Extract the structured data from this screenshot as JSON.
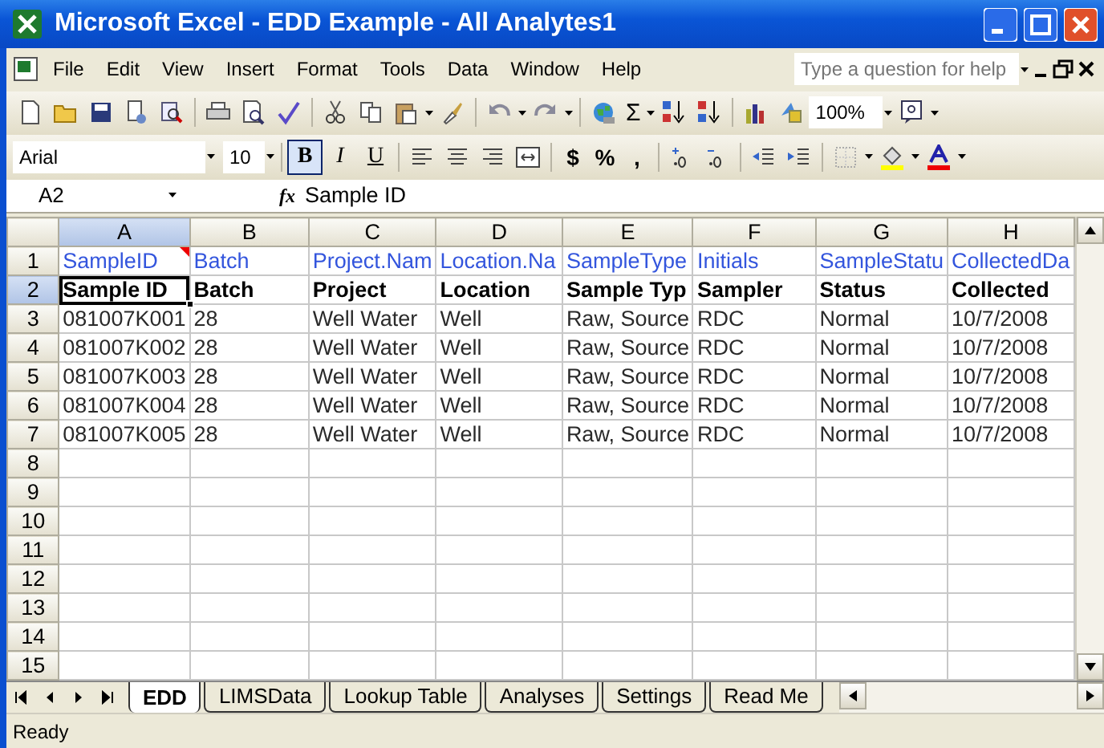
{
  "window": {
    "title": "Microsoft Excel - EDD Example - All Analytes1"
  },
  "menu": [
    "File",
    "Edit",
    "View",
    "Insert",
    "Format",
    "Tools",
    "Data",
    "Window",
    "Help"
  ],
  "help_box": {
    "placeholder": "Type a question for help"
  },
  "standard_toolbar": {
    "sum": "Σ",
    "zoom": "100%"
  },
  "formatting_toolbar": {
    "font": "Arial",
    "size": "10",
    "style_buttons": [
      {
        "label": "B",
        "selected": true
      },
      {
        "label": "I",
        "selected": false
      },
      {
        "label": "U",
        "selected": false
      }
    ],
    "number_buttons": [
      "$",
      "%",
      ","
    ]
  },
  "formula_bar": {
    "name_box": "A2",
    "function_label": "fx",
    "value": "Sample ID"
  },
  "sheet": {
    "columns": [
      {
        "label": "A",
        "selected": true
      },
      {
        "label": "B",
        "selected": false
      },
      {
        "label": "C",
        "selected": false
      },
      {
        "label": "D",
        "selected": false
      },
      {
        "label": "E",
        "selected": false
      },
      {
        "label": "F",
        "selected": false
      },
      {
        "label": "G",
        "selected": false
      },
      {
        "label": "H",
        "selected": false
      }
    ],
    "rows": [
      {
        "number": "1",
        "selected": false,
        "kind": "field_names",
        "cells": [
          {
            "text": "SampleID",
            "comment": true
          },
          {
            "text": "Batch",
            "comment": false
          },
          {
            "text": "Project.Nam",
            "comment": false
          },
          {
            "text": "Location.Na",
            "comment": false
          },
          {
            "text": "SampleType",
            "comment": false
          },
          {
            "text": "Initials",
            "comment": false
          },
          {
            "text": "SampleStatu",
            "comment": false
          },
          {
            "text": "CollectedDa",
            "comment": false
          }
        ]
      },
      {
        "number": "2",
        "selected": true,
        "kind": "header",
        "cells": [
          {
            "text": "Sample ID",
            "comment": false
          },
          {
            "text": "Batch",
            "comment": false
          },
          {
            "text": "Project",
            "comment": false
          },
          {
            "text": "Location",
            "comment": false
          },
          {
            "text": "Sample Typ",
            "comment": false
          },
          {
            "text": "Sampler",
            "comment": false
          },
          {
            "text": "Status",
            "comment": false
          },
          {
            "text": "Collected",
            "comment": false
          }
        ]
      },
      {
        "number": "3",
        "selected": false,
        "kind": "data",
        "cells": [
          {
            "text": "081007K001",
            "comment": false
          },
          {
            "text": "28",
            "comment": false
          },
          {
            "text": "Well Water",
            "comment": false
          },
          {
            "text": "Well",
            "comment": false
          },
          {
            "text": "Raw, Source",
            "comment": false
          },
          {
            "text": "RDC",
            "comment": false
          },
          {
            "text": "Normal",
            "comment": false
          },
          {
            "text": "10/7/2008",
            "comment": false
          }
        ]
      },
      {
        "number": "4",
        "selected": false,
        "kind": "data",
        "cells": [
          {
            "text": "081007K002",
            "comment": false
          },
          {
            "text": "28",
            "comment": false
          },
          {
            "text": "Well Water",
            "comment": false
          },
          {
            "text": "Well",
            "comment": false
          },
          {
            "text": "Raw, Source",
            "comment": false
          },
          {
            "text": "RDC",
            "comment": false
          },
          {
            "text": "Normal",
            "comment": false
          },
          {
            "text": "10/7/2008",
            "comment": false
          }
        ]
      },
      {
        "number": "5",
        "selected": false,
        "kind": "data",
        "cells": [
          {
            "text": "081007K003",
            "comment": false
          },
          {
            "text": "28",
            "comment": false
          },
          {
            "text": "Well Water",
            "comment": false
          },
          {
            "text": "Well",
            "comment": false
          },
          {
            "text": "Raw, Source",
            "comment": false
          },
          {
            "text": "RDC",
            "comment": false
          },
          {
            "text": "Normal",
            "comment": false
          },
          {
            "text": "10/7/2008",
            "comment": false
          }
        ]
      },
      {
        "number": "6",
        "selected": false,
        "kind": "data",
        "cells": [
          {
            "text": "081007K004",
            "comment": false
          },
          {
            "text": "28",
            "comment": false
          },
          {
            "text": "Well Water",
            "comment": false
          },
          {
            "text": "Well",
            "comment": false
          },
          {
            "text": "Raw, Source",
            "comment": false
          },
          {
            "text": "RDC",
            "comment": false
          },
          {
            "text": "Normal",
            "comment": false
          },
          {
            "text": "10/7/2008",
            "comment": false
          }
        ]
      },
      {
        "number": "7",
        "selected": false,
        "kind": "data",
        "cells": [
          {
            "text": "081007K005",
            "comment": false
          },
          {
            "text": "28",
            "comment": false
          },
          {
            "text": "Well Water",
            "comment": false
          },
          {
            "text": "Well",
            "comment": false
          },
          {
            "text": "Raw, Source",
            "comment": false
          },
          {
            "text": "RDC",
            "comment": false
          },
          {
            "text": "Normal",
            "comment": false
          },
          {
            "text": "10/7/2008",
            "comment": false
          }
        ]
      },
      {
        "number": "8",
        "selected": false,
        "kind": "empty"
      },
      {
        "number": "9",
        "selected": false,
        "kind": "empty"
      },
      {
        "number": "10",
        "selected": false,
        "kind": "empty"
      },
      {
        "number": "11",
        "selected": false,
        "kind": "empty"
      },
      {
        "number": "12",
        "selected": false,
        "kind": "empty"
      },
      {
        "number": "13",
        "selected": false,
        "kind": "empty"
      },
      {
        "number": "14",
        "selected": false,
        "kind": "empty"
      },
      {
        "number": "15",
        "selected": false,
        "kind": "empty"
      }
    ]
  },
  "sheet_tabs": [
    {
      "label": "EDD",
      "selected": true
    },
    {
      "label": "LIMSData",
      "selected": false
    },
    {
      "label": "Lookup Table",
      "selected": false
    },
    {
      "label": "Analyses",
      "selected": false
    },
    {
      "label": "Settings",
      "selected": false
    },
    {
      "label": "Read Me",
      "selected": false
    }
  ],
  "status_bar": {
    "text": "Ready"
  }
}
